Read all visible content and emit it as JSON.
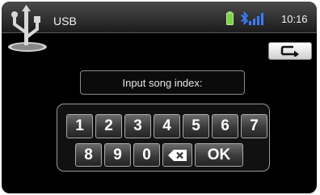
{
  "header": {
    "title": "USB",
    "time": "10:16",
    "status_icons": [
      "battery-icon",
      "bluetooth-icon",
      "signal-icon"
    ]
  },
  "back_button": {
    "icon": "return-arrow-icon"
  },
  "input": {
    "label": "Input song index:"
  },
  "keypad": {
    "row1": [
      "1",
      "2",
      "3",
      "4",
      "5",
      "6",
      "7"
    ],
    "row2": [
      "8",
      "9",
      "0"
    ],
    "backspace_icon": "backspace-icon",
    "ok_label": "OK"
  },
  "colors": {
    "background": "#000000",
    "battery": "#7fd04a",
    "bluetooth": "#3d7cff"
  }
}
